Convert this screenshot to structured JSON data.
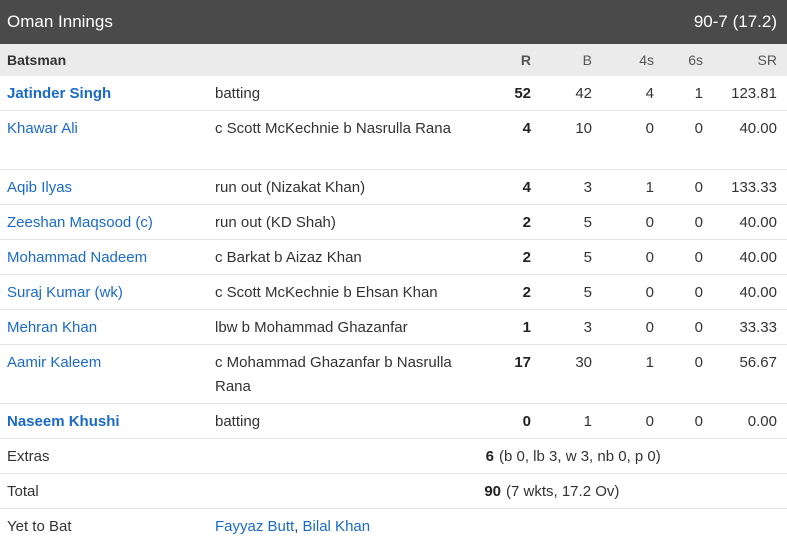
{
  "header": {
    "title": "Oman Innings",
    "score": "90-7 (17.2)"
  },
  "columns": {
    "batsman": "Batsman",
    "r": "R",
    "b": "B",
    "fours": "4s",
    "sixes": "6s",
    "sr": "SR"
  },
  "batsmen": [
    {
      "name": "Jatinder Singh",
      "dismissal": "batting",
      "r": "52",
      "b": "42",
      "fours": "4",
      "sixes": "1",
      "sr": "123.81",
      "active": true
    },
    {
      "name": "Khawar Ali",
      "dismissal": "c Scott McKechnie b Nasrulla Rana",
      "r": "4",
      "b": "10",
      "fours": "0",
      "sixes": "0",
      "sr": "40.00",
      "active": false
    },
    {
      "name": "Aqib Ilyas",
      "dismissal": "run out (Nizakat Khan)",
      "r": "4",
      "b": "3",
      "fours": "1",
      "sixes": "0",
      "sr": "133.33",
      "active": false
    },
    {
      "name": "Zeeshan Maqsood (c)",
      "dismissal": "run out (KD Shah)",
      "r": "2",
      "b": "5",
      "fours": "0",
      "sixes": "0",
      "sr": "40.00",
      "active": false
    },
    {
      "name": "Mohammad Nadeem",
      "dismissal": "c Barkat b Aizaz Khan",
      "r": "2",
      "b": "5",
      "fours": "0",
      "sixes": "0",
      "sr": "40.00",
      "active": false
    },
    {
      "name": "Suraj Kumar (wk)",
      "dismissal": "c Scott McKechnie b Ehsan Khan",
      "r": "2",
      "b": "5",
      "fours": "0",
      "sixes": "0",
      "sr": "40.00",
      "active": false
    },
    {
      "name": "Mehran Khan",
      "dismissal": "lbw b Mohammad Ghazanfar",
      "r": "1",
      "b": "3",
      "fours": "0",
      "sixes": "0",
      "sr": "33.33",
      "active": false
    },
    {
      "name": "Aamir Kaleem",
      "dismissal": "c Mohammad Ghazanfar b Nasrulla Rana",
      "r": "17",
      "b": "30",
      "fours": "1",
      "sixes": "0",
      "sr": "56.67",
      "active": false
    },
    {
      "name": "Naseem Khushi",
      "dismissal": "batting",
      "r": "0",
      "b": "1",
      "fours": "0",
      "sixes": "0",
      "sr": "0.00",
      "active": true
    }
  ],
  "extras": {
    "label": "Extras",
    "total": "6",
    "detail": "(b 0, lb 3, w 3, nb 0, p 0)"
  },
  "total": {
    "label": "Total",
    "runs": "90",
    "detail": "(7 wkts, 17.2 Ov)"
  },
  "yet_to_bat": {
    "label": "Yet to Bat",
    "players": [
      "Fayyaz Butt",
      "Bilal Khan"
    ],
    "separator": ", "
  }
}
